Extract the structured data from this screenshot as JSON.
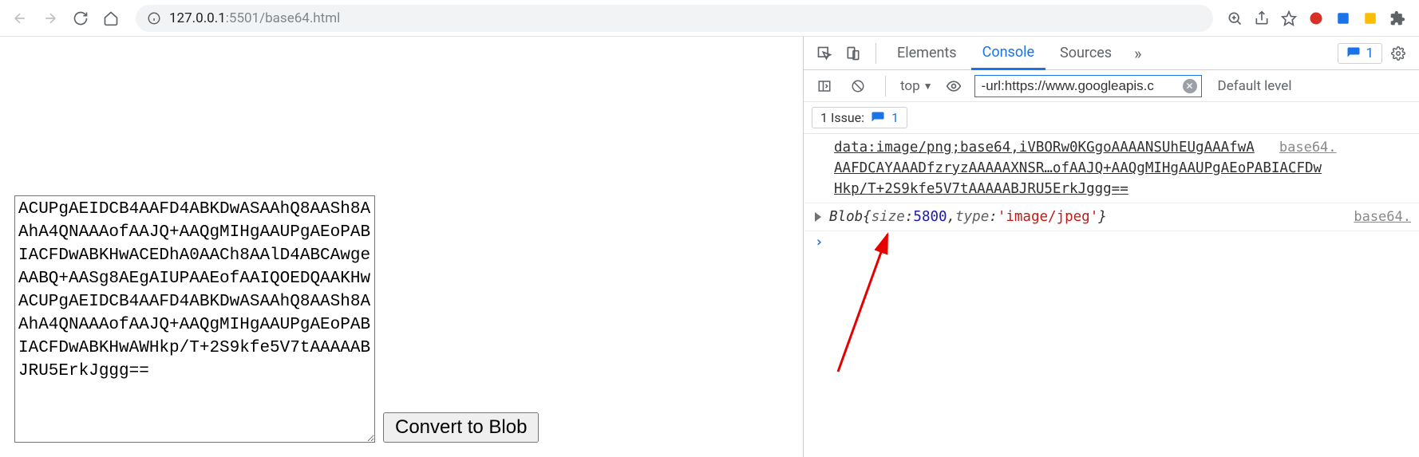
{
  "browser": {
    "url_host": "127.0.0.1",
    "url_port_path": ":5501/base64.html"
  },
  "page": {
    "textarea_value": "ACUPgAEIDCB4AAFD4ABKDwASAAhQ8AASh8AAhA4QNAAAofAAJQ+AAQgMIHgAAUPgAEoPABIACFDwABKHwACEDhA0AACh8AAlD4ABCAwgeAABQ+AASg8AEgAIUPAAEofAAIQOEDQAAKHwACUPgAEIDCB4AAFD4ABKDwASAAhQ8AASh8AAhA4QNAAAofAAJQ+AAQgMIHgAAUPgAEoPABIACFDwABKHwAWHkp/T+2S9kfe5V7tAAAAABJRU5ErkJggg==",
    "button_label": "Convert to Blob"
  },
  "devtools": {
    "tabs": {
      "elements": "Elements",
      "console": "Console",
      "sources": "Sources"
    },
    "filter": {
      "context": "top",
      "value": "-url:https://www.googleapis.c",
      "level": "Default level"
    },
    "issues_badge_count": "1",
    "issues_bar": {
      "prefix": "1 Issue:",
      "count": "1"
    },
    "log": {
      "line1": "data:image/png;base64,iVBORw0KGgoAAAANSUhEUgAAAfwA",
      "line2": "AAFDCAYAAADfzryzAAAAAXNSR…ofAAJQ+AAQgMIHgAAUPgAEoPABIACFDw",
      "line3": "Hkp/T+2S9kfe5V7tAAAAABJRU5ErkJggg==",
      "src1": "base64.",
      "blob_word": "Blob ",
      "blob_open": "{",
      "blob_k1": "size",
      "blob_v1": "5800",
      "blob_c1": ", ",
      "blob_k2": "type",
      "blob_v2": "'image/jpeg'",
      "blob_close": "}",
      "src2": "base64."
    }
  }
}
